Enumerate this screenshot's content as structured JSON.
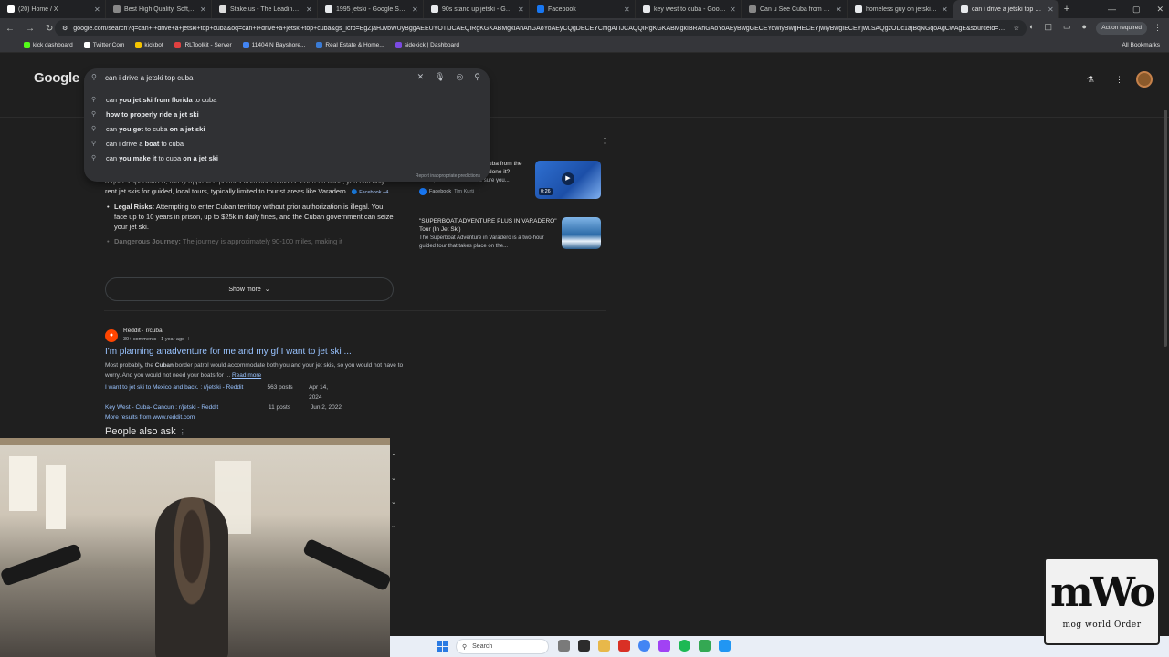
{
  "tabs": [
    {
      "title": "(20) Home / X",
      "icon": "x-logo-icon",
      "color": "#ffffff"
    },
    {
      "title": "Best High Quality, Soft, Slim F",
      "icon": "tab-favicon-icon",
      "color": "#888888"
    },
    {
      "title": "Stake.us - The Leading Social",
      "icon": "stake-icon",
      "color": "#dddddd"
    },
    {
      "title": "1995 jetski - Google Search",
      "icon": "google-icon",
      "color": "#e8eaed"
    },
    {
      "title": "90s stand up jetski - Google S",
      "icon": "google-icon",
      "color": "#e8eaed"
    },
    {
      "title": "Facebook",
      "icon": "facebook-icon",
      "color": "#1877f2"
    },
    {
      "title": "key west to cuba - Google Sea",
      "icon": "google-icon",
      "color": "#e8eaed"
    },
    {
      "title": "Can u See Cuba from Key We",
      "icon": "tab-favicon-icon",
      "color": "#888888"
    },
    {
      "title": "homeless guy on jetski - Goo",
      "icon": "google-icon",
      "color": "#e8eaed"
    },
    {
      "title": "can i drive a jetski top cuba -",
      "icon": "google-icon",
      "color": "#e8eaed",
      "active": true
    }
  ],
  "address": {
    "url": "google.com/search?q=can+i+drive+a+jetski+top+cuba&oq=can+i+drive+a+jetski+top+cuba&gs_lcrp=EgZjaHJvbWUyBggAEEUYOTIJCAEQIRgKGKABMgkIAhAhGAoYoAEyCQgDECEYChigATIJCAQQIRgKGKABMgkIBRAhGAoYoAEyBwgGECEYqwIyBwgHECEYjwIyBwgIECEYjwLSAQgzODc1ajBqNGqoAgCwAgE&sourceid=chrome&ie=U...",
    "action_required": "Action required"
  },
  "bookmarks": [
    {
      "label": "kick dashboard",
      "color": "#53fc18"
    },
    {
      "label": "Twitter Com",
      "color": "#ffffff"
    },
    {
      "label": "kickbot",
      "color": "#f5c400"
    },
    {
      "label": "IRLToolkit - Server",
      "color": "#e04040"
    },
    {
      "label": "11404 N Bayshore...",
      "color": "#4285f4"
    },
    {
      "label": "Real Estate & Home...",
      "color": "#3a7bd5"
    },
    {
      "label": "sidekick | Dashboard",
      "color": "#7b4ae2"
    }
  ],
  "all_bookmarks": "All Bookmarks",
  "google": {
    "logo": "Google",
    "query": "can i drive a jetski top cuba",
    "suggestions": [
      {
        "pre": "can ",
        "bold": "you jet ski from florida",
        "post": " to cuba"
      },
      {
        "pre": "",
        "bold": "how to properly ride a jet ski",
        "post": ""
      },
      {
        "pre": "can ",
        "bold": "you get",
        "post": " to cuba ",
        "bold2": "on a jet ski"
      },
      {
        "pre": "can i drive a ",
        "bold": "boat",
        "post": " to cuba"
      },
      {
        "pre": "can ",
        "bold": "you make it",
        "post": " to cuba ",
        "bold2": "on a jet ski"
      }
    ],
    "report": "Report inappropriate predictions"
  },
  "ai_overview": {
    "intro": "requires specialized, rarely approved permits from both nations. For recreation, you can only rent jet skis for guided, local tours, typically limited to tourist areas like Varadero.",
    "intro_chip": "Facebook +4",
    "bullet1_label": "Legal Risks:",
    "bullet1_text": " Attempting to enter Cuban territory without prior authorization is illegal. You face up to 10 years in prison, up to $25k in daily fines, and the Cuban government can seize your jet ski.",
    "bullet2_label": "Dangerous Journey:",
    "bullet2_text": " The journey is approximately 90-100 miles, making it",
    "show_more": "Show more"
  },
  "cards": [
    {
      "title": "uba from the done it?",
      "snippet": "Dec 5, 2022 — Just make sure you...",
      "source": "Facebook",
      "author": "Tim Kurti",
      "duration": "0:26"
    },
    {
      "title": "\"SUPERBOAT ADVENTURE PLUS IN VARADERO\" Tour (In Jet Ski)",
      "snippet": "The Superboat Adventure in Varadero is a two-hour guided tour that takes place on the..."
    }
  ],
  "reddit": {
    "site": "Reddit · r/cuba",
    "meta": "30+ comments · 1 year ago",
    "title": "I'm planning anadventure for me and my gf I want to jet ski ...",
    "snippet_a": "Most probably, the ",
    "snippet_b": "Cuban",
    "snippet_c": " border patrol would accommodate both you and your jet skis, so you would not have to worry. And you would not need your boats for ...",
    "read_more": "Read more",
    "links": [
      {
        "text": "I want to jet ski to Mexico and back. : r/jetski - Reddit",
        "posts": "563 posts",
        "date": "Apr 14, 2024"
      },
      {
        "text": "Key West - Cuba- Cancun : r/jetski - Reddit",
        "posts": "11 posts",
        "date": "Jun 2, 2022"
      }
    ],
    "more": "More results from www.reddit.com"
  },
  "paa": "People also ask",
  "taskbar": {
    "search": "Search"
  },
  "logo_overlay": {
    "big": "mWo",
    "small": "mog world Order"
  }
}
